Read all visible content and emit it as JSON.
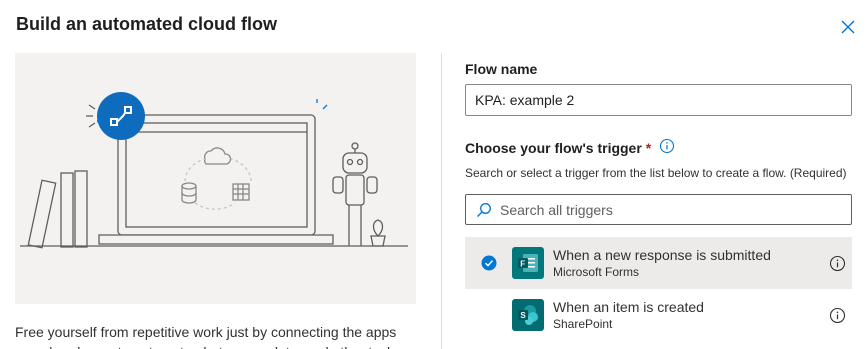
{
  "dialog": {
    "title": "Build an automated cloud flow",
    "close_icon": "close-icon"
  },
  "left": {
    "description": "Free yourself from repetitive work just by connecting the apps you already use to automate alerts, sync data, and other tasks."
  },
  "form": {
    "flow_name_label": "Flow name",
    "flow_name_value": "KPA: example 2",
    "trigger_label": "Choose your flow's trigger",
    "required_marker": "*",
    "helper_text": "Search or select a trigger from the list below to create a flow. (Required)",
    "search_placeholder": "Search all triggers"
  },
  "triggers": [
    {
      "name": "When a new response is submitted",
      "app": "Microsoft Forms",
      "selected": true,
      "icon": "forms-icon",
      "color": "#03787c"
    },
    {
      "name": "When an item is created",
      "app": "SharePoint",
      "selected": false,
      "icon": "sharepoint-icon",
      "color": "#036c70"
    }
  ],
  "colors": {
    "accent": "#0078d4",
    "selected_row": "#edebe9",
    "required": "#a4262c"
  }
}
